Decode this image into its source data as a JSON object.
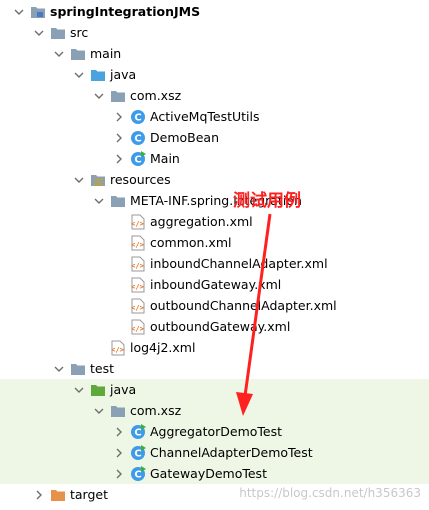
{
  "project": {
    "label": "springIntegrationJMS"
  },
  "tree": {
    "src": "src",
    "main": "main",
    "main_java": "java",
    "main_pkg": "com.xsz",
    "main_classes": [
      "ActiveMqTestUtils",
      "DemoBean",
      "Main"
    ],
    "resources": "resources",
    "meta_inf": "META-INF.spring.integration",
    "xml_files": [
      "aggregation.xml",
      "common.xml",
      "inboundChannelAdapter.xml",
      "inboundGateway.xml",
      "outboundChannelAdapter.xml",
      "outboundGateway.xml"
    ],
    "log4j": "log4j2.xml",
    "test": "test",
    "test_java": "java",
    "test_pkg": "com.xsz",
    "test_classes": [
      "AggregatorDemoTest",
      "ChannelAdapterDemoTest",
      "GatewayDemoTest"
    ],
    "target": "target"
  },
  "annotation": {
    "text": "测试用例",
    "color": "#ff2020"
  },
  "watermark": "https://blog.csdn.net/h356363",
  "colors": {
    "test_row_bg": "#eef7e6",
    "folder": "#8aa0b4",
    "class_icon": "#3d9be9",
    "xml_icon": "#e86e1f",
    "target_folder": "#e8914a",
    "java_src": "#4aa3df",
    "java_test": "#5fa83a"
  },
  "icons": {
    "folder": "folder-icon",
    "class": "class-icon",
    "xml": "xml-file-icon",
    "arrow_open": "chevron-down-icon",
    "arrow_closed": "chevron-right-icon"
  }
}
